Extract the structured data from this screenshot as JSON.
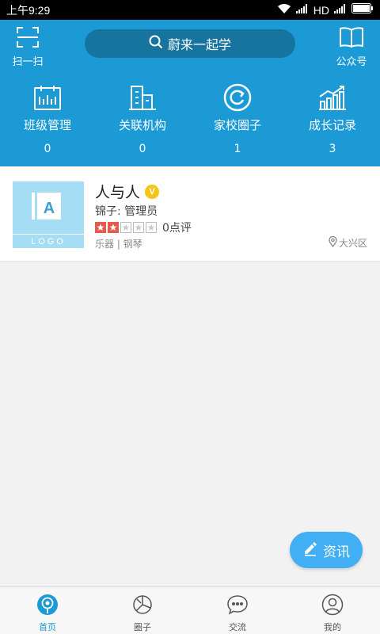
{
  "status_bar": {
    "time": "上午9:29",
    "network": "HD"
  },
  "header": {
    "scan_label": "扫一扫",
    "search_text": "蔚来一起学",
    "gzh_label": "公众号",
    "stats": [
      {
        "label": "班级管理",
        "value": "0",
        "icon": "calendar-icon"
      },
      {
        "label": "关联机构",
        "value": "0",
        "icon": "building-icon"
      },
      {
        "label": "家校圈子",
        "value": "1",
        "icon": "circle-refresh-icon"
      },
      {
        "label": "成长记录",
        "value": "3",
        "icon": "growth-chart-icon"
      }
    ]
  },
  "card": {
    "logo_letter": "A",
    "logo_text": "LOGO",
    "title": "人与人",
    "badge": "V",
    "subtitle": "锦子: 管理员",
    "rating": 2,
    "rating_max": 5,
    "rating_text": "0点评",
    "tags": "乐器 | 钢琴",
    "location": "大兴区"
  },
  "fab": {
    "label": "资讯"
  },
  "bottom_nav": [
    {
      "label": "首页",
      "active": true
    },
    {
      "label": "圈子",
      "active": false
    },
    {
      "label": "交流",
      "active": false
    },
    {
      "label": "我的",
      "active": false
    }
  ],
  "colors": {
    "primary": "#1b9ad6",
    "search_bg": "#17749f",
    "fab": "#42aef3",
    "star_red": "#e55a4e",
    "badge": "#f5c518"
  }
}
